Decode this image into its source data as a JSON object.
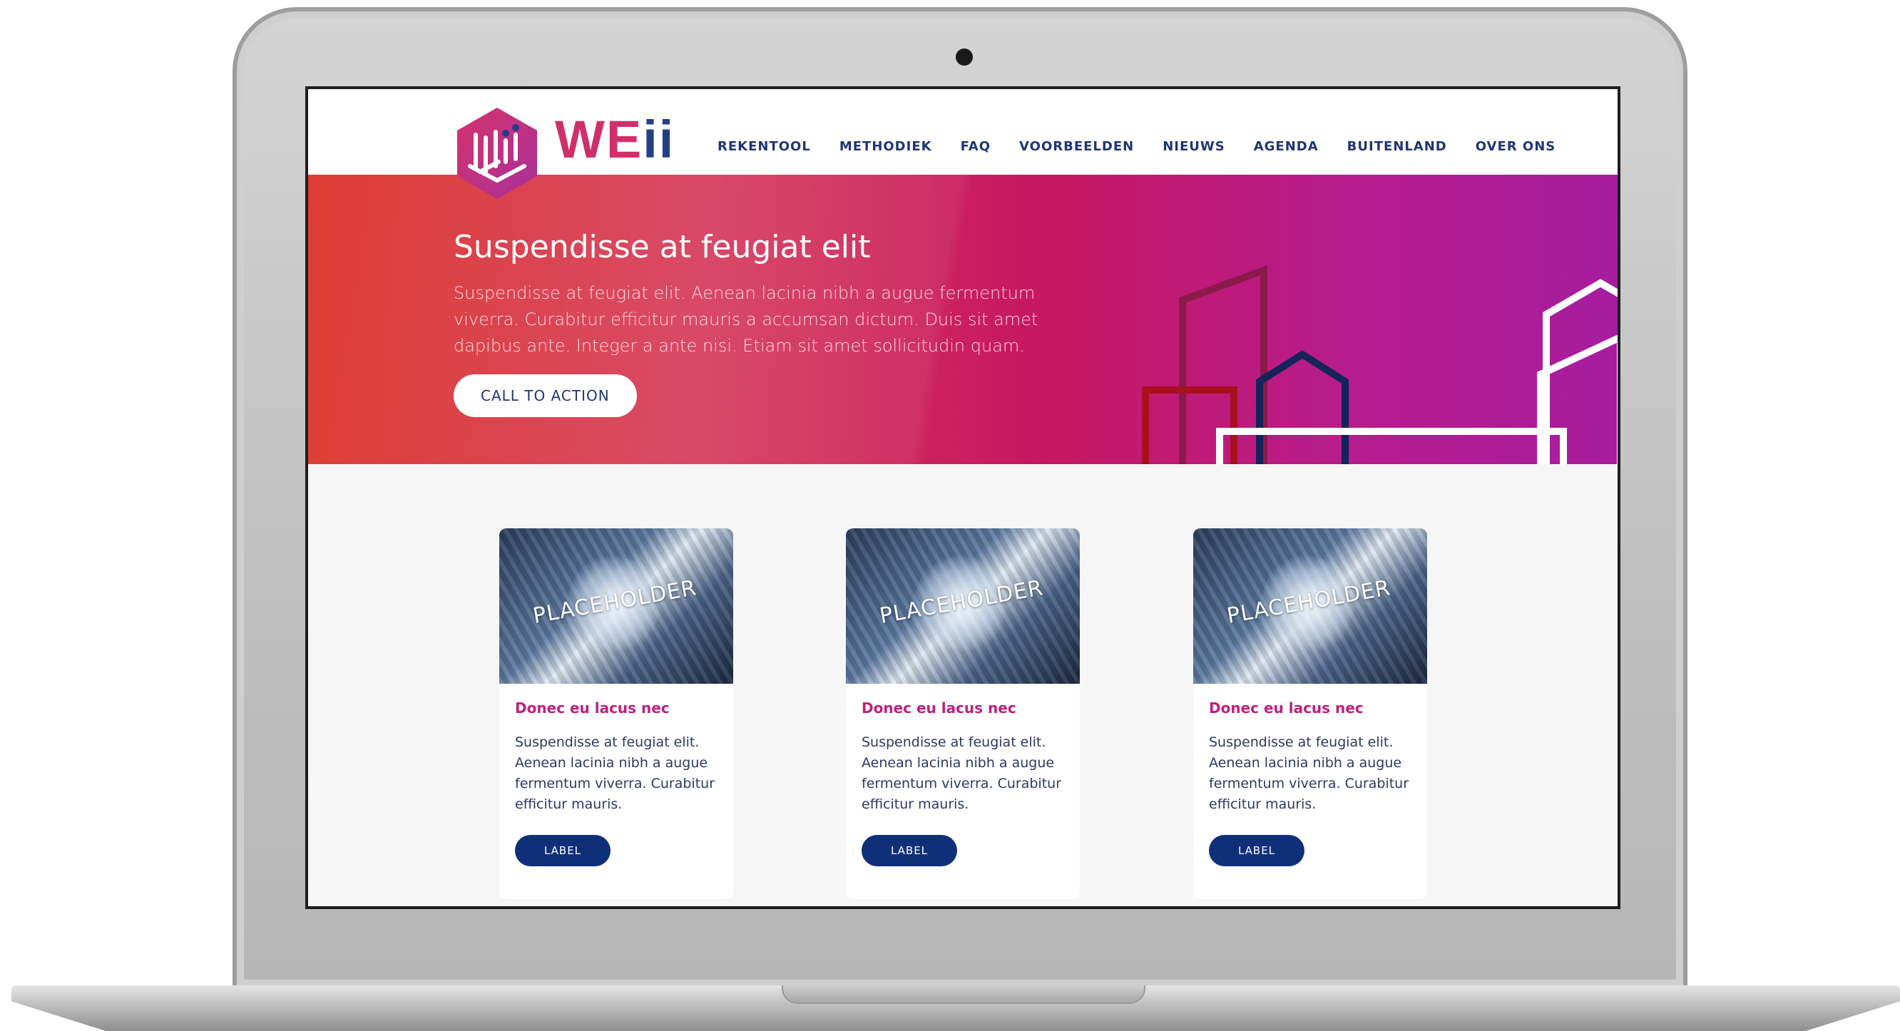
{
  "brand": {
    "name_main": "WE",
    "name_accent": "ii"
  },
  "nav": {
    "items": [
      "REKENTOOL",
      "METHODIEK",
      "FAQ",
      "VOORBEELDEN",
      "NIEUWS",
      "AGENDA",
      "BUITENLAND",
      "OVER ONS"
    ]
  },
  "hero": {
    "title": "Suspendisse at feugiat elit",
    "text": "Suspendisse at feugiat elit. Aenean lacinia nibh a augue fermentum viverra. Curabitur efficitur mauris a accumsan dictum. Duis sit amet dapibus ante. Integer a ante nisi. Etiam sit amet sollicitudin quam.",
    "cta_label": "CALL TO ACTION"
  },
  "cards": [
    {
      "image_text": "PLACEHOLDER",
      "title": "Donec eu lacus nec",
      "text": "Suspendisse at feugiat elit. Aenean lacinia nibh a augue fermentum viverra. Curabitur efficitur mauris.",
      "button": "LABEL"
    },
    {
      "image_text": "PLACEHOLDER",
      "title": "Donec eu lacus nec",
      "text": "Suspendisse at feugiat elit. Aenean lacinia nibh a augue fermentum viverra. Curabitur efficitur mauris.",
      "button": "LABEL"
    },
    {
      "image_text": "PLACEHOLDER",
      "title": "Donec eu lacus nec",
      "text": "Suspendisse at feugiat elit. Aenean lacinia nibh a augue fermentum viverra. Curabitur efficitur mauris.",
      "button": "LABEL"
    }
  ],
  "colors": {
    "brand_pink": "#d0306a",
    "brand_navy": "#243f86",
    "card_title": "#c0207e",
    "button_navy": "#0f2f78",
    "hero_start": "#dd3d33",
    "hero_end": "#a61d9e"
  }
}
